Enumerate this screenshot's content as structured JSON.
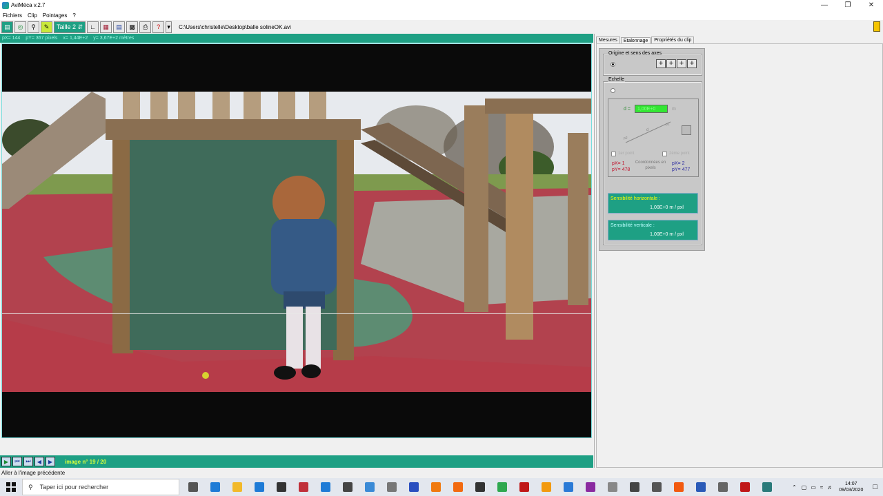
{
  "window": {
    "title": "AviMéca v.2.7"
  },
  "menu": [
    "Fichiers",
    "Clip",
    "Pointages",
    "?"
  ],
  "toolbar": {
    "size_label": "Taille 2",
    "file_path": "C:\\Users\\christelle\\Desktop\\balle solineOK.avi"
  },
  "coordbar": {
    "px": "pX= 144",
    "py": "pY= 367 pixels",
    "x": "x= 1,44E+2",
    "y": "y= 3,67E+2 mètres"
  },
  "tabs": [
    "Mesures",
    "Etalonnage",
    "Propriétés du clip"
  ],
  "calibration": {
    "origin_title": "Origine et sens des axes",
    "scale_title": "Echelle",
    "distance_label": "d =",
    "distance_value": "1,00E+0",
    "distance_unit": "m",
    "point1_label": "1er point",
    "point2_label": "2ème point",
    "p1x": "pX= 1",
    "p1y": "pY= 478",
    "p2x": "pX= 2",
    "p2y": "pY= 477",
    "coords_label": "Coordonnées en pixels",
    "sens_h_label": "Sensibilité horizontale :",
    "sens_h_value": "1,00E+0 m / pxl",
    "sens_v_label": "Sensibilité verticale :",
    "sens_v_value": "1,00E+0 m / pxl"
  },
  "navigation": {
    "image_label": "image n°",
    "current": "19",
    "separator": "/",
    "total": "20"
  },
  "status": {
    "text": "Aller à l'image précédente"
  },
  "taskbar": {
    "search_placeholder": "Taper ici pour rechercher",
    "time": "14:07",
    "date": "09/03/2020",
    "apps": [
      "task-view",
      "edge",
      "file-explorer",
      "downloads",
      "store",
      "gift",
      "mail",
      "settings",
      "photos",
      "audio",
      "headphones",
      "vlc",
      "avast",
      "calculator-app",
      "chrome",
      "acrobat",
      "illustrator",
      "photoshop",
      "premiere",
      "draw",
      "notepad",
      "calculator",
      "firefox",
      "word",
      "fingerprint",
      "media-player",
      "avimeca"
    ]
  },
  "colors": {
    "teal": "#1ea084",
    "green_field": "#33e633",
    "red": "#c0102a",
    "blue": "#2a2aa0"
  }
}
